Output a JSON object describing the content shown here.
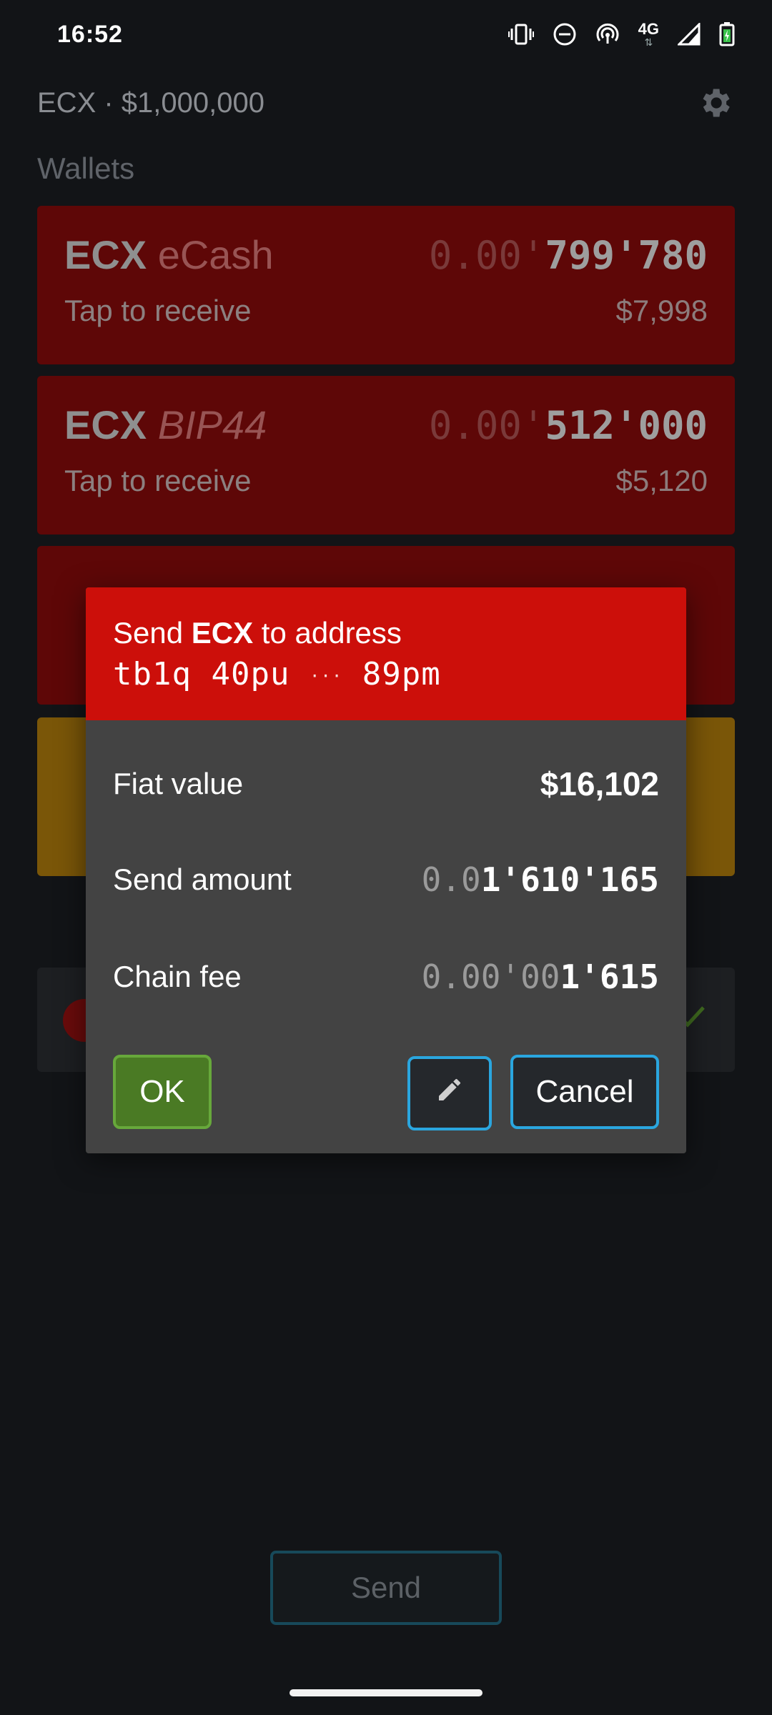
{
  "status_bar": {
    "time": "16:52",
    "network": "4G",
    "icons": [
      "vibrate-icon",
      "dnd-icon",
      "hotspot-icon",
      "signal-icon",
      "battery-icon"
    ]
  },
  "header": {
    "title": "ECX · $1,000,000",
    "settings_icon": "gear-icon"
  },
  "wallets": {
    "section_title": "Wallets",
    "items": [
      {
        "name": "ECX",
        "subname": "eCash",
        "amount_dim": "0.00'",
        "amount_bright": "799'780",
        "action": "Tap to receive",
        "fiat": "$7,998",
        "color": "#5e0707"
      },
      {
        "name": "ECX",
        "subname": "BIP44",
        "amount_dim": "0.00'",
        "amount_bright": "512'000",
        "action": "Tap to receive",
        "fiat": "$5,120",
        "color": "#5e0707"
      }
    ]
  },
  "dialog": {
    "header_prefix": "Send",
    "header_currency": "ECX",
    "header_suffix": "to address",
    "addr_part1": "tb1q",
    "addr_part2": "40pu",
    "addr_sep": "···",
    "addr_part3": "89pm",
    "fiat_label": "Fiat value",
    "fiat_value": "$16,102",
    "amount_label": "Send amount",
    "amount_dim": "0.0",
    "amount_bright": "1'610'165",
    "fee_label": "Chain fee",
    "fee_dim": "0.00'00",
    "fee_bright": "1'615",
    "ok_label": "OK",
    "edit_icon": "pencil-icon",
    "cancel_label": "Cancel",
    "header_color": "#cc0f0a"
  },
  "send_button": {
    "label": "Send"
  }
}
